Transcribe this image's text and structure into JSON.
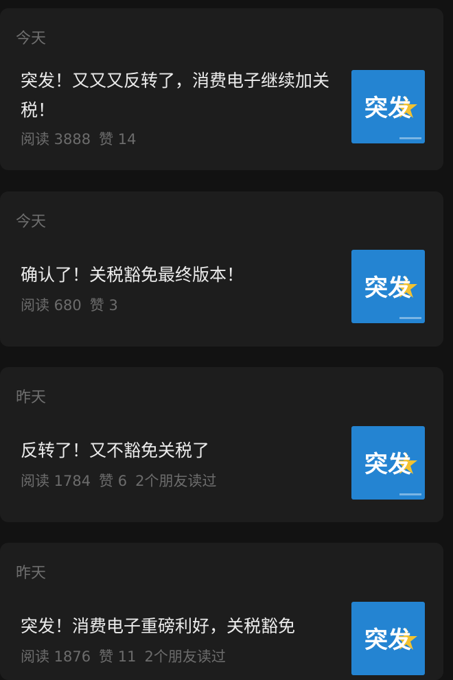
{
  "articles": [
    {
      "day": "今天",
      "title": "突发！又又又反转了，消费电子继续加关税！",
      "reads": "阅读 3888",
      "likes": "赞 14",
      "friends": "",
      "thumb_text": "突发"
    },
    {
      "day": "今天",
      "title": "确认了！关税豁免最终版本！",
      "reads": "阅读 680",
      "likes": "赞 3",
      "friends": "",
      "thumb_text": "突发"
    },
    {
      "day": "昨天",
      "title": "反转了！又不豁免关税了",
      "reads": "阅读 1784",
      "likes": "赞 6",
      "friends": "2个朋友读过",
      "thumb_text": "突发"
    },
    {
      "day": "昨天",
      "title": "突发！消费电子重磅利好，关税豁免",
      "reads": "阅读 1876",
      "likes": "赞 11",
      "friends": "2个朋友读过",
      "thumb_text": "突发"
    }
  ],
  "colors": {
    "background": "#121212",
    "card": "#1d1d1d",
    "thumb_blue": "#1a78c8",
    "thumb_star": "#f2c230"
  }
}
